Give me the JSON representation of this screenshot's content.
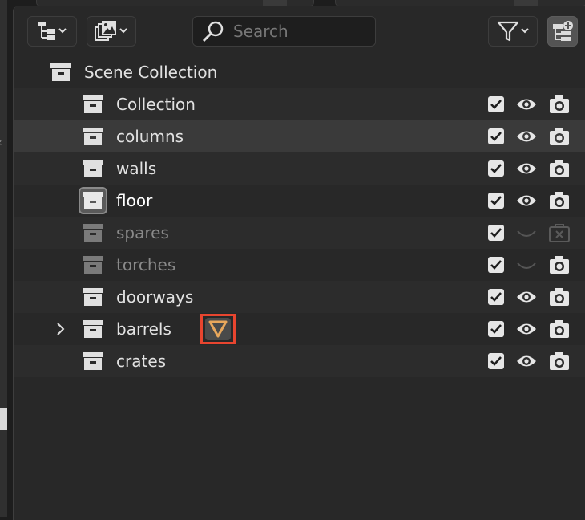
{
  "header": {
    "display_mode_icon": "outliner-tree-icon",
    "filter_icon": "funnel-icon",
    "search": {
      "placeholder": "Search",
      "value": ""
    },
    "new_collection_icon": "new-collection-icon"
  },
  "tree": {
    "root": {
      "label": "Scene Collection",
      "icon": "collection-icon"
    },
    "items": [
      {
        "label": "Collection",
        "excluded": false,
        "eye": "visible",
        "camera": "enabled",
        "state": "normal"
      },
      {
        "label": "columns",
        "excluded": false,
        "eye": "visible",
        "camera": "enabled",
        "state": "selected"
      },
      {
        "label": "walls",
        "excluded": false,
        "eye": "visible",
        "camera": "enabled",
        "state": "normal"
      },
      {
        "label": "floor",
        "excluded": false,
        "eye": "visible",
        "camera": "enabled",
        "state": "active"
      },
      {
        "label": "spares",
        "excluded": false,
        "eye": "hidden",
        "camera": "disabled",
        "state": "dim"
      },
      {
        "label": "torches",
        "excluded": false,
        "eye": "hidden",
        "camera": "enabled",
        "state": "dim"
      },
      {
        "label": "doorways",
        "excluded": false,
        "eye": "visible",
        "camera": "enabled",
        "state": "normal"
      },
      {
        "label": "barrels",
        "excluded": false,
        "eye": "visible",
        "camera": "enabled",
        "state": "normal",
        "expandable": true,
        "child_icon": "modifier-icon"
      },
      {
        "label": "crates",
        "excluded": false,
        "eye": "visible",
        "camera": "enabled",
        "state": "normal"
      }
    ]
  },
  "colors": {
    "background": "#282828",
    "highlight": "#e8452f",
    "modifier_orange": "#e8a75c"
  }
}
